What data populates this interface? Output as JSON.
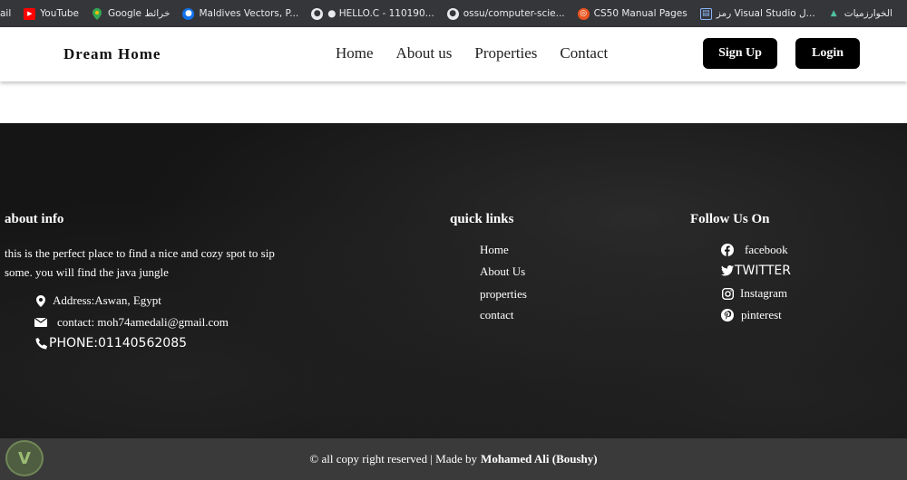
{
  "bookmarks": [
    {
      "label": "ail",
      "icon": "truncated-icon"
    },
    {
      "label": "YouTube",
      "icon": "youtube-icon"
    },
    {
      "label": "Google خرائط",
      "icon": "google-maps-icon"
    },
    {
      "label": "Maldives Vectors, P...",
      "icon": "freepik-icon"
    },
    {
      "label": "● HELLO.C - 110190...",
      "icon": "github-icon"
    },
    {
      "label": "ossu/computer-scie...",
      "icon": "github-icon"
    },
    {
      "label": "CS50 Manual Pages",
      "icon": "ubuntu-icon"
    },
    {
      "label": "رمز Visual Studio ل...",
      "icon": "book-icon"
    },
    {
      "label": "الخوارزميات",
      "icon": "algo-icon"
    }
  ],
  "header": {
    "brand": "Dream Home",
    "nav": [
      "Home",
      "About us",
      "Properties",
      "Contact"
    ],
    "signup_label": "Sign Up",
    "login_label": "Login"
  },
  "footer": {
    "about": {
      "title": "about info",
      "text": "this is the perfect place to find a nice and cozy spot to sip some. you will find the java jungle",
      "address": "Address:Aswan, Egypt",
      "contact": "contact: moh74amedali@gmail.com",
      "phone": "PHONE:01140562085"
    },
    "quick_links": {
      "title": "quick links",
      "items": [
        "Home",
        "About Us",
        "properties",
        "contact"
      ]
    },
    "follow": {
      "title": "Follow Us On",
      "items": [
        {
          "label": "facebook",
          "icon": "facebook-icon"
        },
        {
          "label": "TWITTER",
          "icon": "twitter-icon"
        },
        {
          "label": "Instagram",
          "icon": "instagram-icon"
        },
        {
          "label": "pinterest",
          "icon": "pinterest-icon"
        }
      ]
    }
  },
  "copyright": {
    "text": "© all copy right reserved | Made by",
    "author": "Mohamed Ali (Boushy)"
  }
}
